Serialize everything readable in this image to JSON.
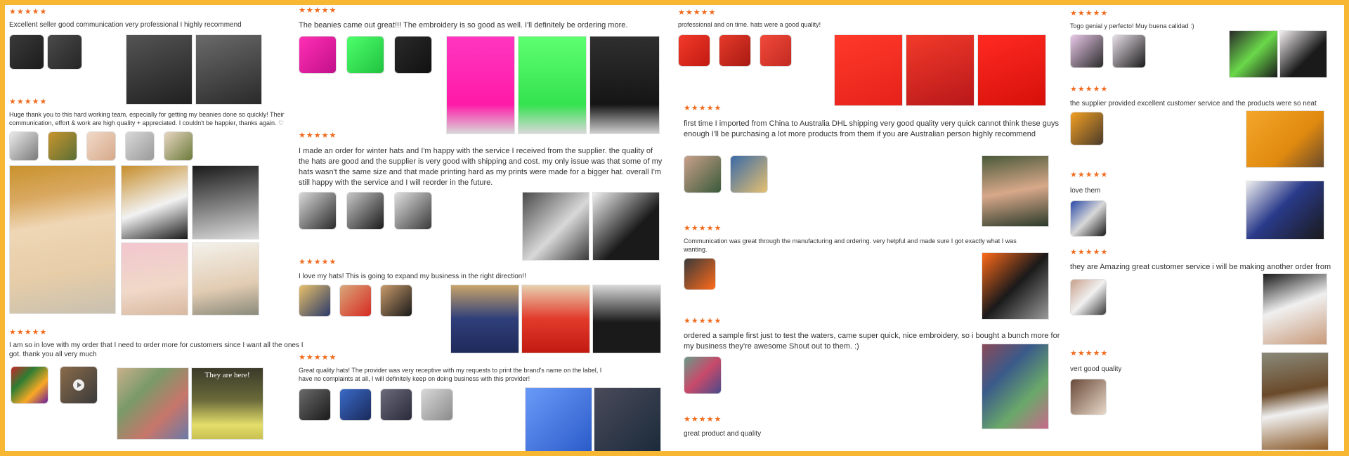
{
  "stars": "★★★★★",
  "reviews": [
    "Excellent seller good communication very professional I highly recommend",
    "Huge thank you to this hard working team, especially for getting my beanies done so quickly! Their communication, effort & work are high quality + appreciated. I couldn't be happier, thanks again. ♡",
    "I am so in love with my order that I need to order more for customers since I want all the ones I got. thank you all very much",
    "The beanies came out great!!! The embroidery is so good as well. I'll definitely be ordering more.",
    "I made an order for winter hats and I'm happy with the service I received from the supplier. the quality of the hats are good and the supplier is very good with shipping and cost. my only issue was that some of my hats wasn't the same size and that made printing hard as my prints were made for a bigger hat. overall I'm still happy with the service and I will reorder in the future.",
    "I love my hats! This is going to expand my business in the right direction!!",
    "Great quality hats! The provider was very receptive with my requests to print the brand's name on the label, I have no complaints at all, I will definitely keep on doing business with this provider!",
    "professional and on time. hats were a good quality!",
    "first time I imported from China to Australia DHL shipping very good quality very quick cannot think these guys enough I'll be purchasing a lot more products from them if you are Australian person highly recommend",
    "Communication was great through the manufacturing and ordering. very helpful and made sure I got exactly what I was wanting.",
    "ordered a sample first just to test the waters, came super quick, nice embroidery, so i bought a bunch more for my business they're awesome Shout out to them. :)",
    "great product and quality",
    "Togo genial y perfecto! Muy buena calidad :)",
    "the supplier provided excellent customer service and the products were so neat",
    "love them",
    "they are Amazing great customer service i will be making another order from",
    "vert good quality"
  ],
  "photo_overlay": "They are here!",
  "colors": {
    "frame": "#f7b733",
    "stars": "#f06a1d",
    "text": "#333333"
  }
}
